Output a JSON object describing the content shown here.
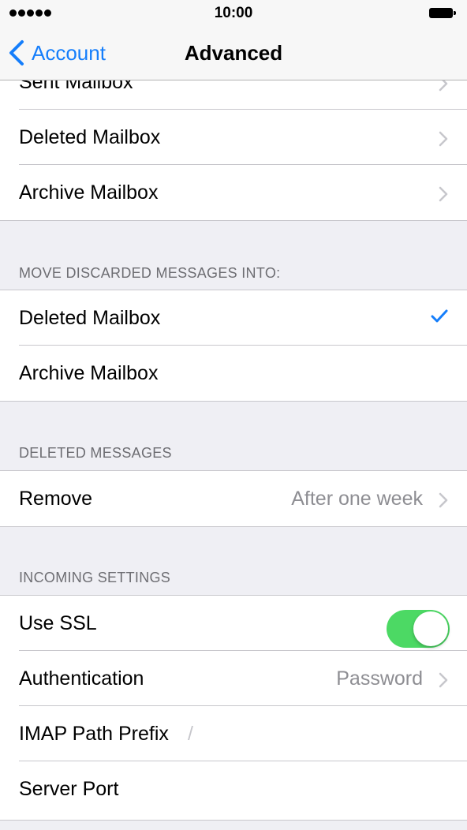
{
  "status_bar": {
    "time": "10:00"
  },
  "nav": {
    "back_label": "Account",
    "title": "Advanced"
  },
  "sections": {
    "mailbox_behaviors": {
      "items": [
        {
          "label": "Sent Mailbox"
        },
        {
          "label": "Deleted Mailbox"
        },
        {
          "label": "Archive Mailbox"
        }
      ]
    },
    "move_discarded": {
      "header": "MOVE DISCARDED MESSAGES INTO:",
      "items": [
        {
          "label": "Deleted Mailbox",
          "selected": true
        },
        {
          "label": "Archive Mailbox",
          "selected": false
        }
      ]
    },
    "deleted_messages": {
      "header": "DELETED MESSAGES",
      "items": [
        {
          "label": "Remove",
          "value": "After one week"
        }
      ]
    },
    "incoming_settings": {
      "header": "INCOMING SETTINGS",
      "items": [
        {
          "label": "Use SSL",
          "toggle_on": true
        },
        {
          "label": "Authentication",
          "value": "Password"
        },
        {
          "label": "IMAP Path Prefix",
          "value": "/"
        },
        {
          "label": "Server Port"
        }
      ]
    }
  },
  "colors": {
    "accent": "#157efb",
    "toggle_on": "#4cd964",
    "background": "#efeff4",
    "secondary_text": "#8e8e93"
  },
  "icons": {
    "back": "chevron-left-icon",
    "disclosure": "chevron-right-icon",
    "selected": "checkmark-icon"
  }
}
